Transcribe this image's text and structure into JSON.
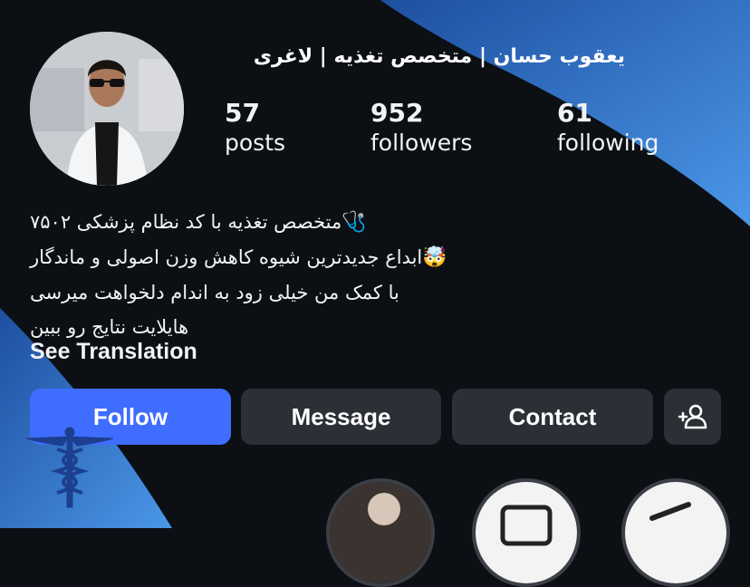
{
  "profile": {
    "name": "یعقوب حسان | متخصص تغذیه | لاغری",
    "stats": [
      {
        "value": "57",
        "label": "posts"
      },
      {
        "value": "952",
        "label": "followers"
      },
      {
        "value": "61",
        "label": "following"
      }
    ],
    "bio": {
      "line1": "متخصص تغذیه با کد نظام پزشکی ۷۵۰۲",
      "line1_emoji": "🩺",
      "line2": "ابداع جدیدترین شیوه کاهش وزن اصولی و ماندگار",
      "line2_emoji": "🤯",
      "line3": "با کمک من خیلی زود به اندام دلخواهت میرسی",
      "line4": "هایلایت نتایج رو ببین"
    },
    "see_translation": "See Translation"
  },
  "actions": {
    "follow": "Follow",
    "message": "Message",
    "contact": "Contact"
  },
  "colors": {
    "background": "#0c0f14",
    "follow_button": "#3f6dff",
    "secondary_button": "#2b2f36",
    "swoosh_blue": "#3a7fd5"
  },
  "icons": [
    "add-user-icon",
    "caduceus-icon",
    "stethoscope-icon",
    "exploding-head-icon"
  ]
}
